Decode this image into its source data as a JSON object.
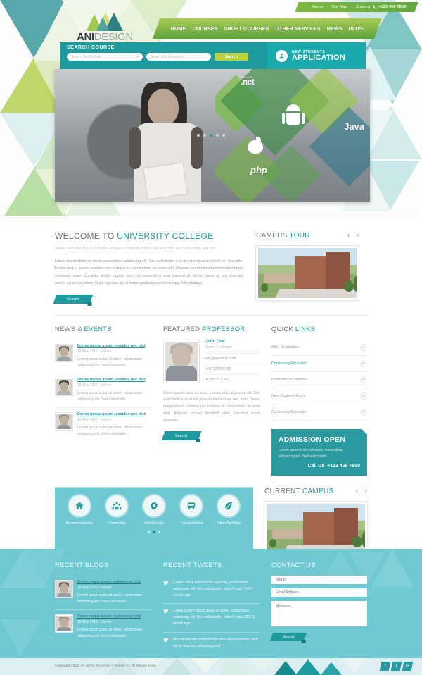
{
  "topbar": {
    "links": [
      "Home",
      "Site Map",
      "Support"
    ],
    "separator": "::",
    "phone": "+123 456 7890",
    "phone_icon": "phone-icon"
  },
  "logo": {
    "part1": "ANI",
    "part2": "DESIGN"
  },
  "nav": {
    "items": [
      "HOME",
      "COURSES",
      "SHORT COURSES",
      "OTHER SERVICES",
      "NEWS",
      "BLOG"
    ]
  },
  "search_course": {
    "title": "SEARCH COURSE",
    "attribute_placeholder": "Search By Attribute",
    "keywords_placeholder": "Search By Keywords",
    "button": "Search",
    "new_students": {
      "small": "NEW STUDENTS",
      "large": "APPLICATION",
      "icon": "student-application-icon"
    }
  },
  "hero": {
    "tech_labels": {
      "net_small": "Microsoft",
      "net": ".net",
      "java": "Java",
      "php": "php"
    },
    "slide_count": 5,
    "active_slide": 3
  },
  "welcome": {
    "title_plain": "WELCOME TO ",
    "title_highlight": "UNIVERSITY COLLEGE",
    "subtitle": "Donec sed odio dui. Duis mollis, est non commodo luctus, nisi erat odio dui. Duis mollis, est non",
    "body": "Lorem ipsum dolor sit amet, consectetur adipiscing elit. Sed sollicitudin erat ut est pretium eleifend vel nec ante. Donec neque ipsum, sodales nec tristique at, consectetur sit amet velit. Aliquam laoreet tincidunt interdum turpis venenatis vitae. Curabitur mollis sagittis nunc, at consectetur erat placerat at. Morbir lacus ac nisi pharetra lacinia eu pretum diam. Nulla egestas dui et tortor vestibulum pellentesque felis tristique.",
    "button": "Search"
  },
  "campus_tour": {
    "title_plain": "CAMPUS ",
    "title_highlight": "TOUR",
    "prev_icon": "chevron-left-icon",
    "next_icon": "chevron-right-icon"
  },
  "current_campus": {
    "title_plain": "CURRENT ",
    "title_highlight": "CAMPUS",
    "prev_icon": "chevron-left-icon",
    "next_icon": "chevron-right-icon"
  },
  "news": {
    "title_plain": "NEWS & ",
    "title_highlight": "EVENTS",
    "items": [
      {
        "title": "Donec neque ipsum, sodales nec trist",
        "meta": "19 May 2012 :: Admin",
        "desc": "Lorem ipsum dolor sit amet, consectetur adipiscing elit. Sed sollicitudin..."
      },
      {
        "title": "Donec neque ipsum, sodales nec trist",
        "meta": "19 May 2012 :: Admin",
        "desc": "Lorem ipsum dolor sit amet, consectetur adipiscing elit. Sed sollicitudin..."
      },
      {
        "title": "Donec neque ipsum, sodales nec trist",
        "meta": "19 May 2012 :: Admin",
        "desc": "Lorem ipsum dolor sit amet, consectetur adipiscing elit. Sed sollicitudin..."
      }
    ]
  },
  "professor": {
    "title_plain": "FEATURED ",
    "title_highlight": "PROFESSOR",
    "name": "John Doe",
    "role": "Maths Professor",
    "email": "info@johndoe.com",
    "phone": "+91-123456789",
    "hours": "10 am to 5 pm",
    "body": "Lorem ipsum dolor sit amet, consectetur adipiscing elit. Sed sollicitudin erat ut est pretium eleifend vel nec ante. Donec neque ipsum, sodales nec tristique at, consectetur sit amet velit. Aliquam laoreet tincidunt vitae interdum turpis venenati...",
    "button": "Search"
  },
  "quick_links": {
    "title_plain": "QUICK ",
    "title_highlight": "LINKS",
    "items": [
      {
        "label": "After Graduation",
        "active": false
      },
      {
        "label": "Continuing Education",
        "active": true
      },
      {
        "label": "International Student",
        "active": false
      },
      {
        "label": "New Students Apply",
        "active": false
      },
      {
        "label": "Continuing Education",
        "active": false
      }
    ],
    "star_icon": "star-icon"
  },
  "admission": {
    "heading": "ADMISSION OPEN",
    "text": "Lorem ipsum dolor sit amet, consectetur adipiscing elit. Sed sollicitudin...",
    "call_label": "Call Us",
    "call_number": "+123 456 7890"
  },
  "facilities": {
    "items": [
      {
        "label": "Accommodations",
        "icon": "home-icon"
      },
      {
        "label": "Community",
        "icon": "people-icon"
      },
      {
        "label": "Scholarships",
        "icon": "gear-icon"
      },
      {
        "label": "Transportation",
        "icon": "bus-icon"
      },
      {
        "label": "Other Facilities",
        "icon": "leaf-icon"
      }
    ],
    "dot_count": 3,
    "active_dot": 2
  },
  "recent_blogs": {
    "title": "RECENT BLOGS",
    "items": [
      {
        "title": "Donec neque ipsum, sodales nec trist",
        "meta": "19 May 2012 :: Admin",
        "desc": "Lorem ipsum dolor sit amet, consectetur adipiscing elit. Sed sollicitudin..."
      },
      {
        "title": "Donec neque ipsum, sodales nec trist",
        "meta": "19 May 2012 :: Admin",
        "desc": "Lorem ipsum dolor sit amet, consectetur adipiscing elit. Sed sollicitudin..."
      }
    ]
  },
  "recent_tweets": {
    "title": "RECENT TWEETS",
    "icon": "twitter-bird-icon",
    "items": [
      "CheckLorem ipsum dolor sit amet, consectetur adipiscing elit. Sed sollicitudin.. http://vca/sY2rd 2 weeks ago",
      "Check Lorem ipsum dolor sit amet, consectetur adipiscing elit. Sed sollicitudin.. http://vca/qaZM2 1 month ago",
      "Michael Moran understands what few Americao. that we've reached a tipping point"
    ]
  },
  "contact": {
    "title": "CONTACT US",
    "name_placeholder": "Name",
    "email_placeholder": "Email Address",
    "message_placeholder": "Message",
    "submit": "Submit"
  },
  "bottom": {
    "copyright": "Copyright 2012, All rights Reserved   ||   Design by JD Design India",
    "socials": [
      {
        "name": "facebook-icon",
        "glyph": "f"
      },
      {
        "name": "twitter-icon",
        "glyph": "t"
      },
      {
        "name": "google-plus-icon",
        "glyph": "G"
      }
    ]
  },
  "colors": {
    "teal": "#1d9a9e",
    "light_teal": "#6fc9d2",
    "green": "#7fb842",
    "lime": "#bcd141"
  }
}
